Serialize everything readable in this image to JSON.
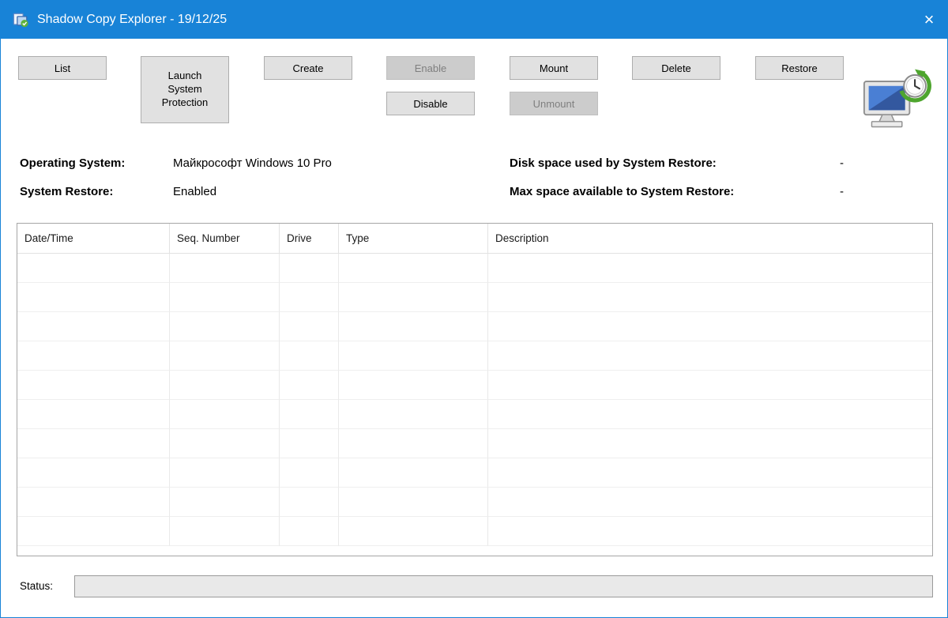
{
  "window": {
    "title": "Shadow Copy Explorer - 19/12/25",
    "close_glyph": "×"
  },
  "toolbar": {
    "list": "List",
    "launch_system_protection": "Launch System Protection",
    "create": "Create",
    "enable": "Enable",
    "disable": "Disable",
    "mount": "Mount",
    "unmount": "Unmount",
    "delete": "Delete",
    "restore": "Restore"
  },
  "info": {
    "os_label": "Operating System:",
    "os_value": "Майкрософт Windows 10 Pro",
    "system_restore_label": "System Restore:",
    "system_restore_value": "Enabled",
    "disk_used_label": "Disk space used by System Restore:",
    "disk_used_value": "-",
    "max_space_label": "Max space available to System Restore:",
    "max_space_value": "-"
  },
  "table": {
    "columns": [
      "Date/Time",
      "Seq. Number",
      "Drive",
      "Type",
      "Description"
    ],
    "rows": []
  },
  "status": {
    "label": "Status:",
    "value": ""
  },
  "icons": {
    "app": "shadow-copy-app-icon",
    "hero": "system-restore-icon",
    "close": "close-icon"
  },
  "colors": {
    "titlebar_bg": "#1883d7",
    "window_border": "#1883d7",
    "button_bg": "#e1e1e1",
    "button_border": "#adadad",
    "disabled_text": "#7f7f7f"
  }
}
